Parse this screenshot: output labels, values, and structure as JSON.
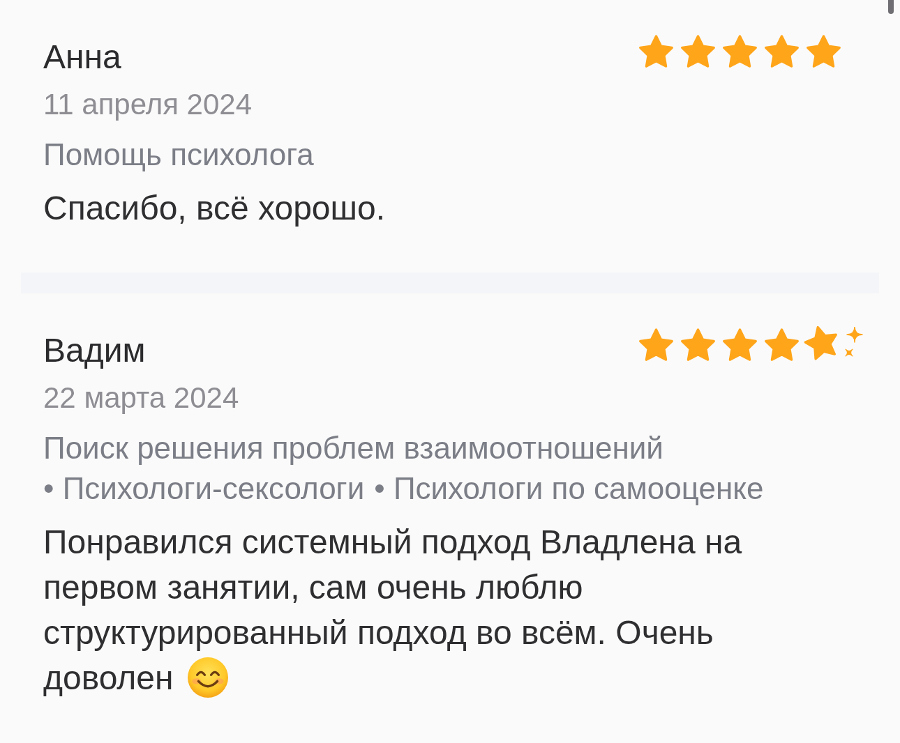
{
  "reviews": [
    {
      "name": "Анна",
      "stars": 5,
      "sparkle": false,
      "date": "11 апреля 2024",
      "services": [
        "Помощь психолога"
      ],
      "text": "Спасибо, всё хорошо.",
      "emoji": false
    },
    {
      "name": "Вадим",
      "stars": 5,
      "sparkle": true,
      "date": "22 марта 2024",
      "services": [
        "Поиск решения проблем взаимоотношений",
        "• Психологи-сексологи",
        "• Психологи по самооценке"
      ],
      "text": "Понравился системный подход Владлена на первом занятии, сам очень люблю структурированный подход во всём. Очень доволен",
      "emoji": true
    }
  ]
}
